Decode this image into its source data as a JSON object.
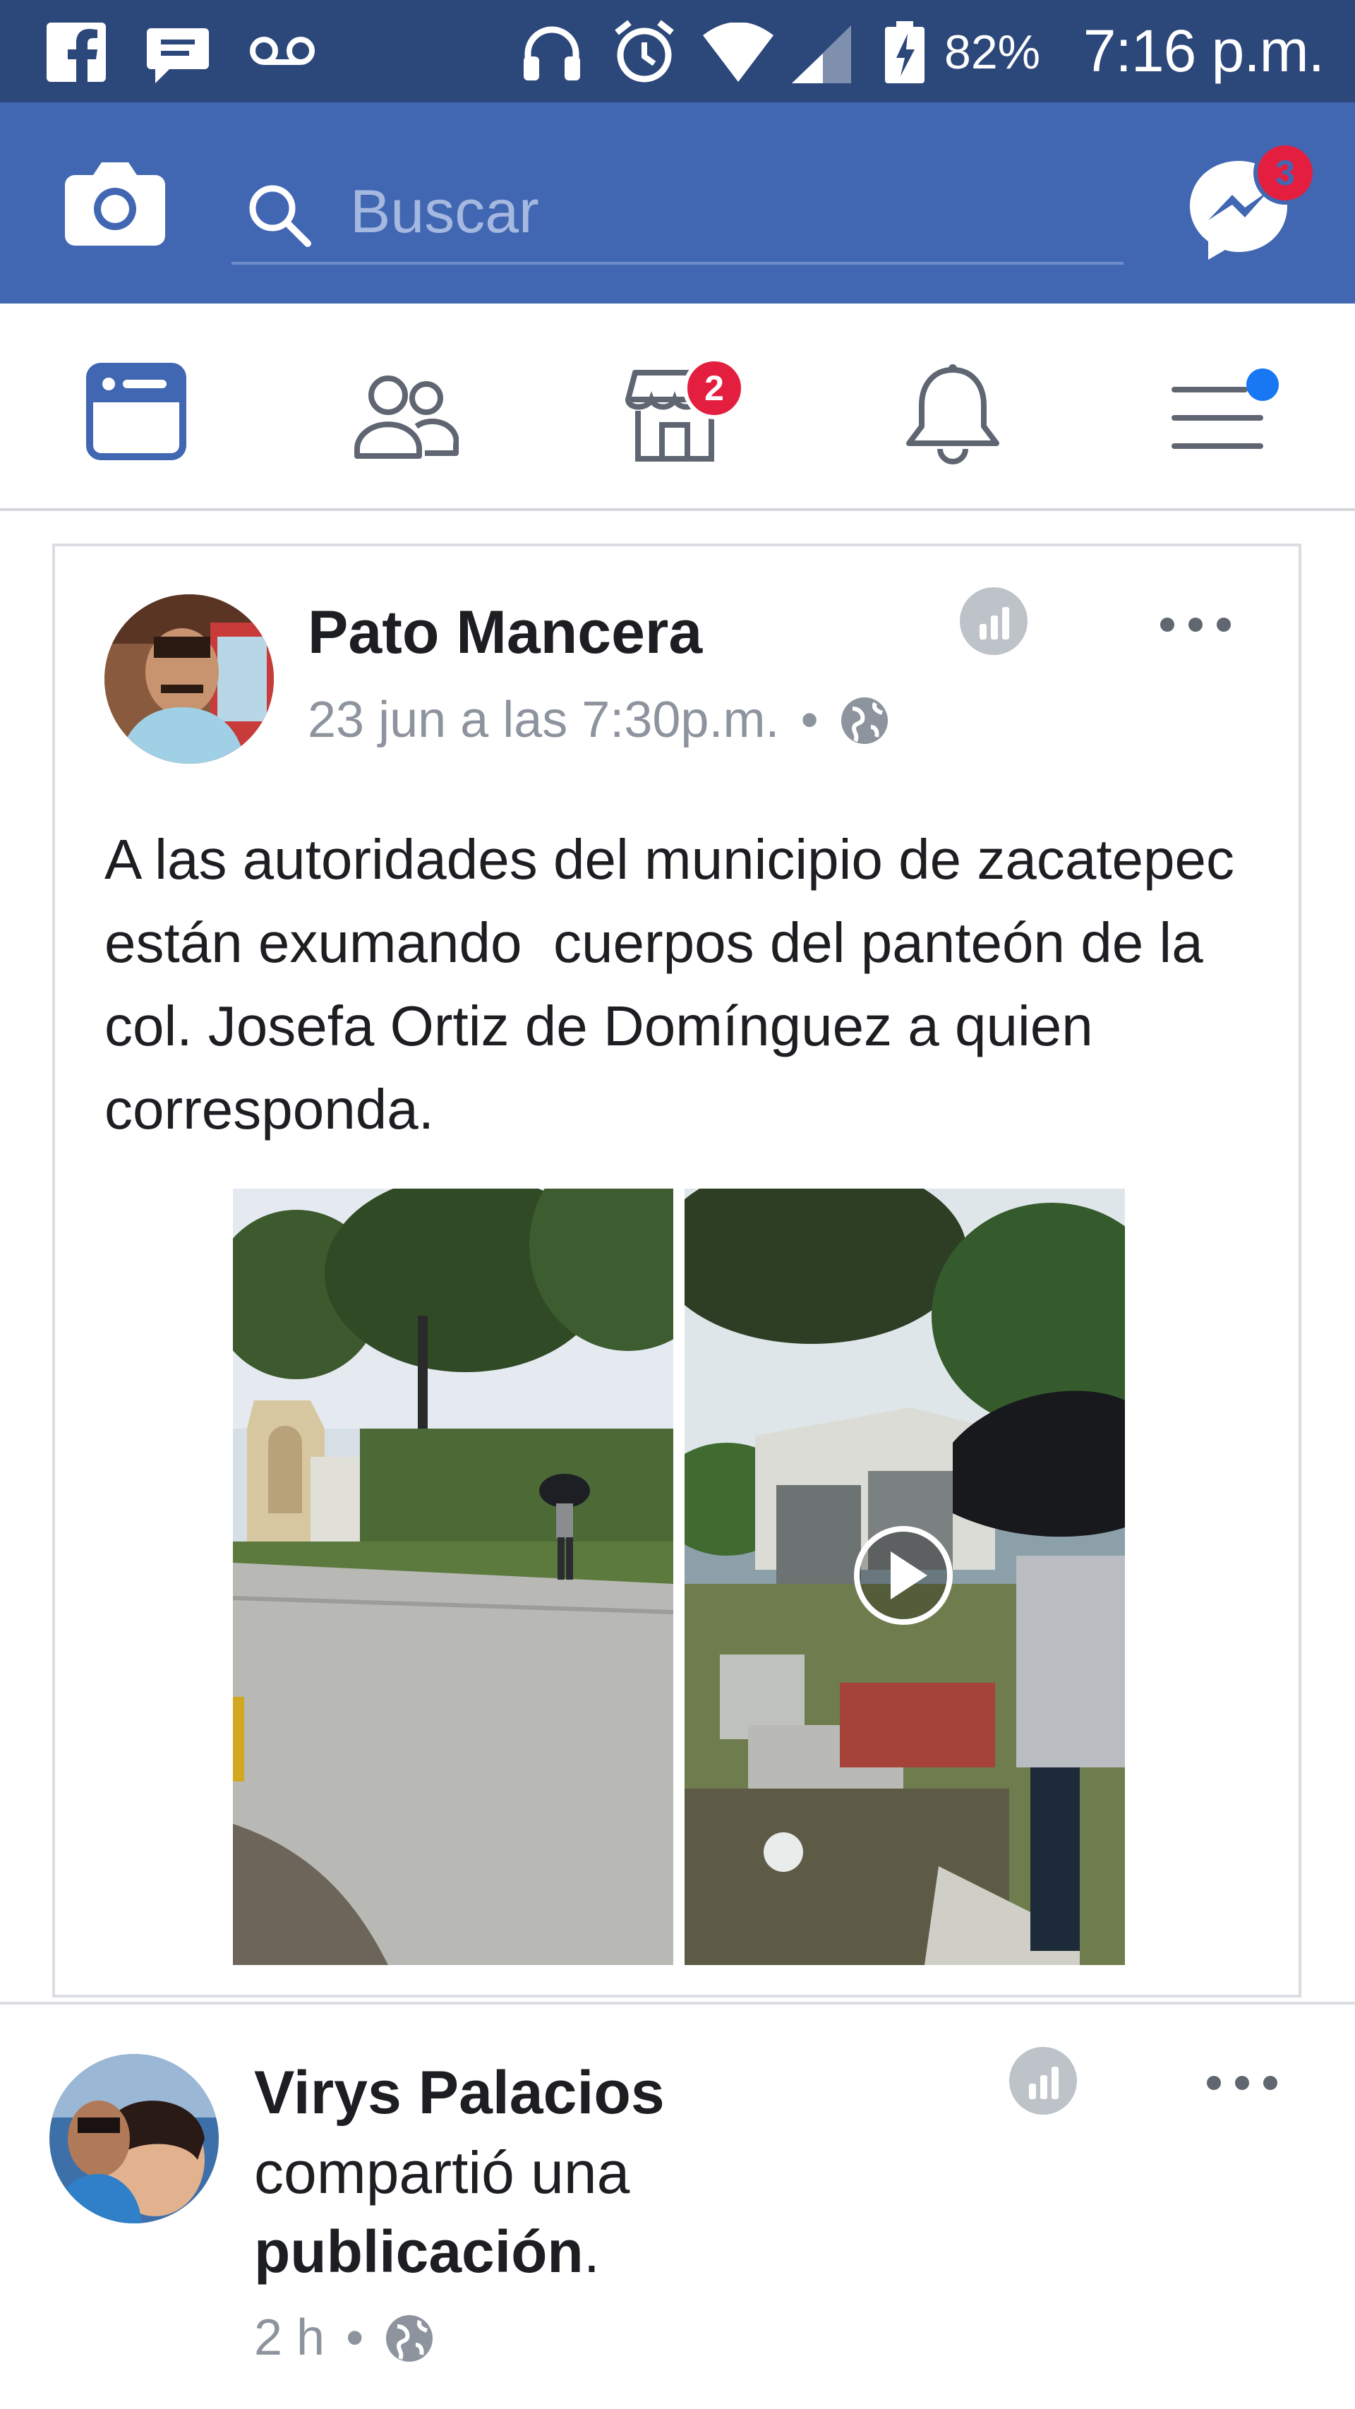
{
  "status_bar": {
    "battery_percent": "82%",
    "time": "7:16 p.m.",
    "left_icons": [
      "facebook-icon",
      "message-icon",
      "voicemail-icon"
    ],
    "right_icons": [
      "headphones-icon",
      "alarm-icon",
      "wifi-icon",
      "signal-icon",
      "battery-charging-icon"
    ]
  },
  "top_bar": {
    "camera_icon": "camera-icon",
    "search_placeholder": "Buscar",
    "messenger_badge": "3"
  },
  "nav_tabs": {
    "items": [
      {
        "name": "news-feed",
        "icon": "news-feed-icon",
        "active": true
      },
      {
        "name": "friends",
        "icon": "friends-icon"
      },
      {
        "name": "marketplace",
        "icon": "marketplace-icon",
        "badge": "2"
      },
      {
        "name": "notifications",
        "icon": "bell-icon"
      },
      {
        "name": "menu",
        "icon": "menu-icon",
        "dot": true
      }
    ]
  },
  "posts": [
    {
      "author": "Pato Mancera",
      "timestamp": "23 jun a las 7:30p.m.",
      "separator": "•",
      "text": "A las autoridades del municipio de zacatepec están exumando  cuerpos del panteón de la col. Josefa Ortiz de Domínguez a quien corresponda.",
      "media": [
        "street-photo",
        "cemetery-video"
      ]
    },
    {
      "author": "Virys Palacios",
      "action_text": "compartió una",
      "action_link": "publicación",
      "action_end": ".",
      "timestamp": "2 h",
      "separator": "•"
    }
  ],
  "colors": {
    "status_bar": "#2c4779",
    "top_bar": "#4267b2",
    "accent": "#4267b2",
    "badge": "#e41e3f"
  }
}
